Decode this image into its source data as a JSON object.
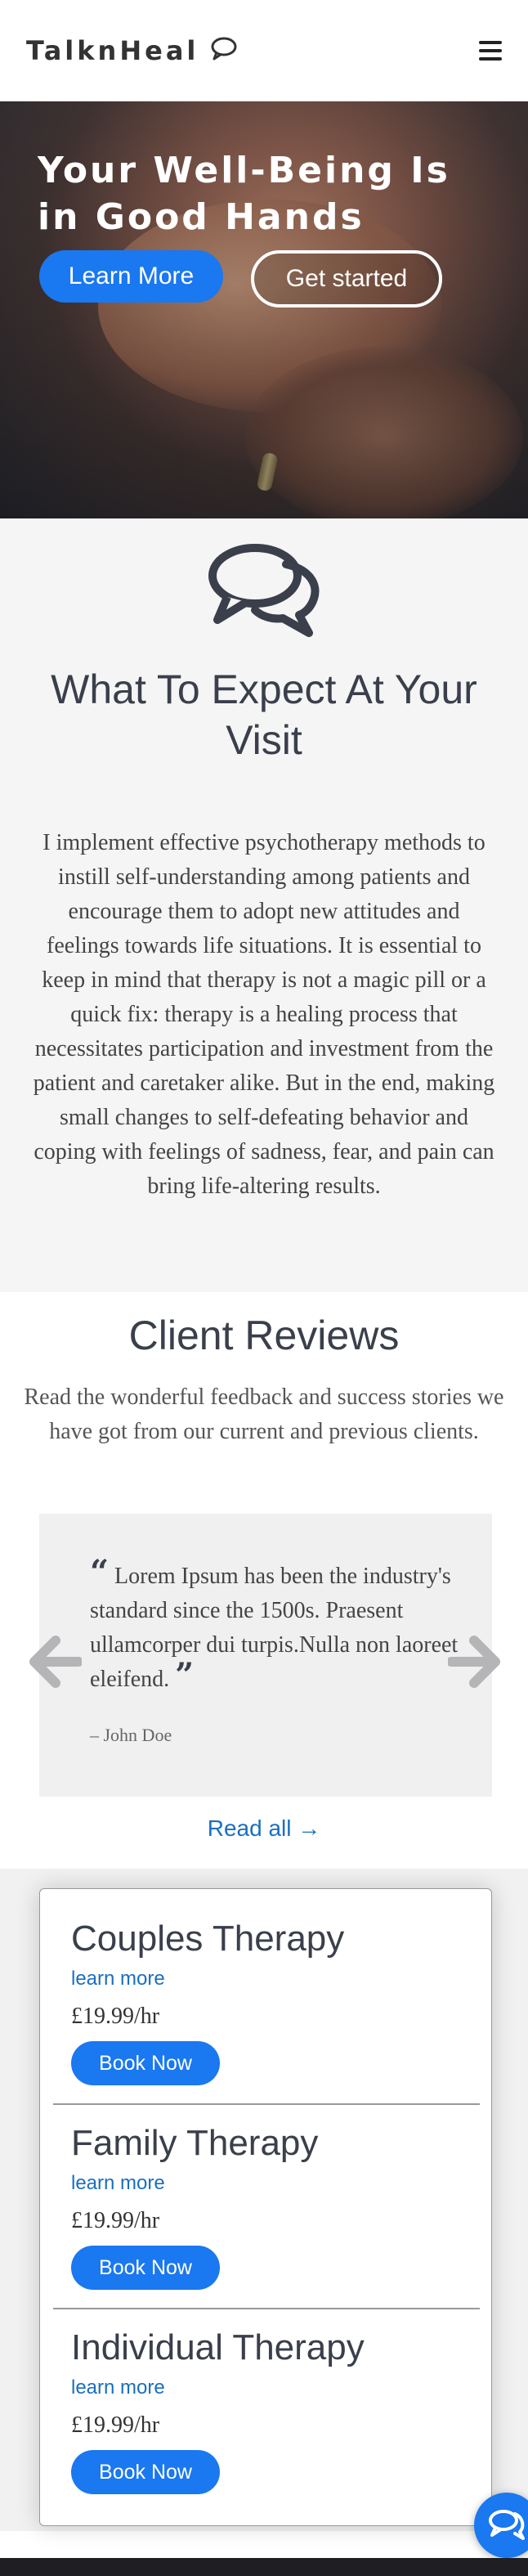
{
  "header": {
    "brand": "TalknHeal",
    "brand_icon": "chat-bubble-icon",
    "menu_icon": "hamburger-menu-icon"
  },
  "hero": {
    "title": "Your Well-Being Is in Good Hands",
    "learn_more": "Learn More",
    "get_started": "Get started"
  },
  "expect": {
    "icon": "chat-bubbles-icon",
    "title": "What To Expect At Your Visit",
    "text": "I implement effective psychotherapy methods to instill self-understanding among patients and encourage them to adopt new attitudes and feelings towards life situations. It is essential to keep in mind that therapy is not a magic pill or a quick fix: therapy is a healing process that necessitates participation and investment from the patient and caretaker alike. But in the end, making small changes to self-defeating behavior and coping with feelings of sadness, fear, and pain can bring life-altering results."
  },
  "reviews": {
    "title": "Client Reviews",
    "subtitle": "Read the wonderful feedback and success stories we have got from our current and previous clients.",
    "quote": "Lorem Ipsum has been the industry's standard since the 1500s. Praesent ullamcorper dui turpis.Nulla non laoreet eleifend.",
    "reviewer": "– John Doe",
    "read_all": "Read all →",
    "prev_icon": "arrow-left-icon",
    "next_icon": "arrow-right-icon"
  },
  "services": [
    {
      "name": "Couples Therapy",
      "link": "learn more",
      "price": "£19.99/hr",
      "button": "Book Now"
    },
    {
      "name": "Family Therapy",
      "link": "learn more",
      "price": "£19.99/hr",
      "button": "Book Now"
    },
    {
      "name": "Individual Therapy",
      "link": "learn more",
      "price": "£19.99/hr",
      "button": "Book Now"
    }
  ],
  "colors": {
    "accent": "#1a78f0",
    "link": "#1a6fbf",
    "heading": "#3a3f4b",
    "section_bg": "#f5f5f6"
  },
  "chat_fab_icon": "chat-icon"
}
